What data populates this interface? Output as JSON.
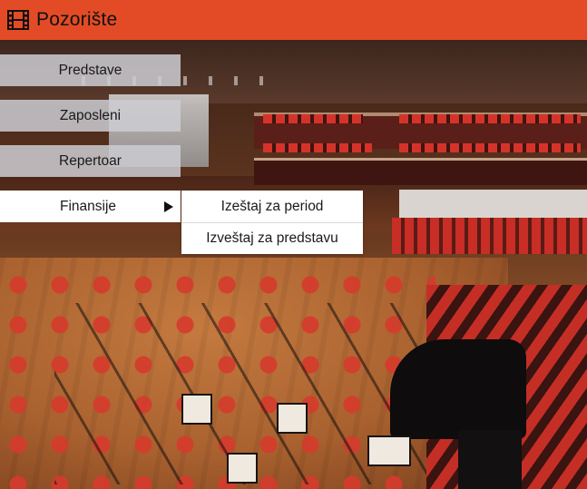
{
  "header": {
    "title": "Pozorište",
    "icon": "film-icon",
    "background_color": "#e34b26"
  },
  "menu": {
    "items": [
      {
        "label": "Predstave"
      },
      {
        "label": "Zaposleni"
      },
      {
        "label": "Repertoar"
      },
      {
        "label": "Finansije",
        "expanded": true,
        "arrow_icon": "play-arrow-icon"
      }
    ]
  },
  "submenu": {
    "items": [
      {
        "label": "Izeštaj za period"
      },
      {
        "label": "Izveštaj za predstavu"
      }
    ]
  },
  "background": {
    "image": "concert-hall-photo"
  }
}
